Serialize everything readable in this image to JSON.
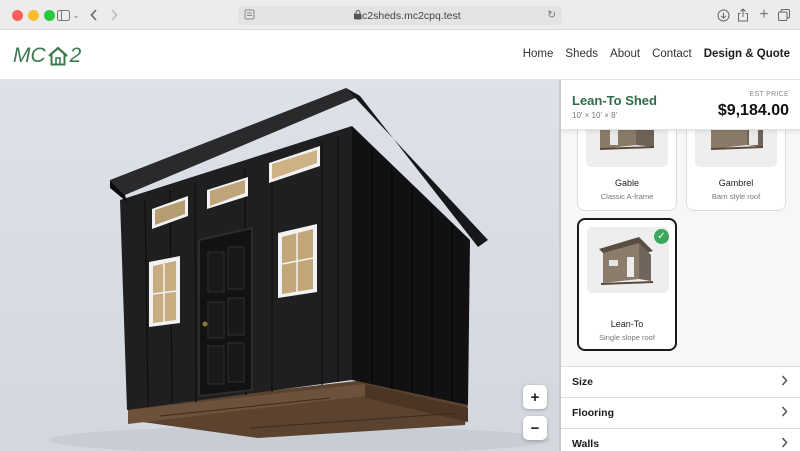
{
  "browser": {
    "url": "mc2sheds.mc2cpq.test"
  },
  "header": {
    "logo_left": "MC",
    "logo_right": "2",
    "nav": [
      "Home",
      "Sheds",
      "About",
      "Contact",
      "Design & Quote"
    ]
  },
  "viewer": {
    "zoom_in": "+",
    "zoom_out": "−"
  },
  "summary": {
    "name": "Lean-To Shed",
    "dims": "10' × 10' × 8'",
    "est_label": "EST PRICE",
    "price": "$9,184.00"
  },
  "roof_styles": [
    {
      "name": "Gable",
      "desc": "Classic A-frame",
      "selected": false
    },
    {
      "name": "Gambrel",
      "desc": "Barn style roof",
      "selected": false
    },
    {
      "name": "Lean-To",
      "desc": "Single slope roof",
      "selected": true
    }
  ],
  "sections": [
    "Size",
    "Flooring",
    "Walls"
  ],
  "colors": {
    "accent": "#2f6e45",
    "shed_body": "#1d1d1f",
    "check": "#3aa85c"
  }
}
